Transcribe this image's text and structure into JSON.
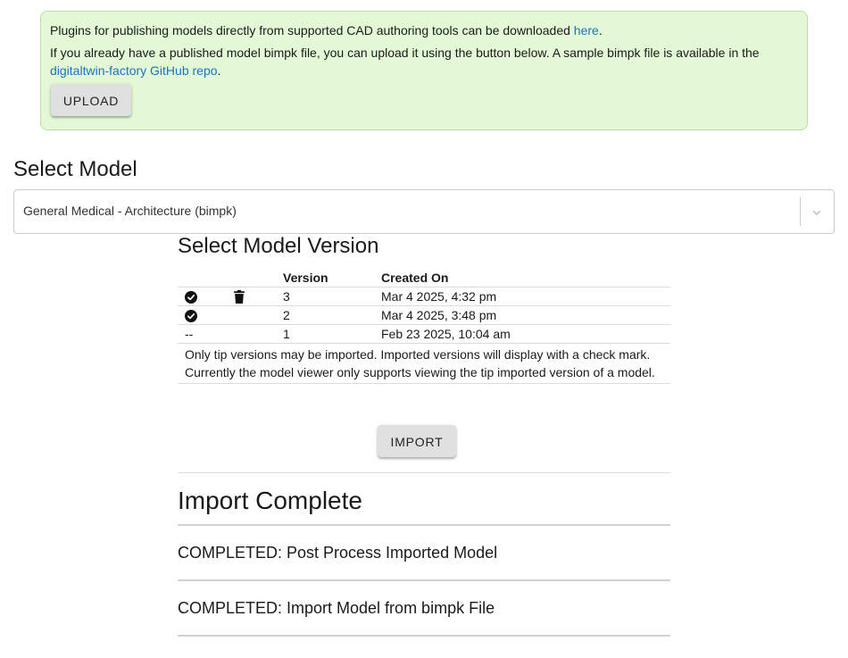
{
  "notice": {
    "line1_text": "Plugins for publishing models directly from supported CAD authoring tools can be downloaded ",
    "line1_link": "here",
    "line1_end": ".",
    "line2_text": "If you already have a published model bimpk file, you can upload it using the button below. A sample bimpk file is available in the ",
    "line2_link": "digitaltwin-factory GitHub repo",
    "line2_end": ".",
    "upload_label": "UPLOAD",
    "background_color": "#e3f9d6"
  },
  "select_model": {
    "heading": "Select Model",
    "selected_value": "General Medical - Architecture (bimpk)",
    "dropdown_icon": "chevron-down-icon"
  },
  "select_version": {
    "heading": "Select Model Version",
    "columns": [
      "",
      "",
      "Version",
      "Created On"
    ],
    "rows": [
      {
        "imported": "check-circle-icon",
        "action": "trash-icon",
        "version": "3",
        "created_on": "Mar 4 2025, 4:32 pm"
      },
      {
        "imported": "check-circle-icon",
        "action": "",
        "version": "2",
        "created_on": "Mar 4 2025, 3:48 pm"
      },
      {
        "imported_text": "--",
        "action": "",
        "version": "1",
        "created_on": "Feb 23 2025, 10:04 am"
      }
    ],
    "note": "Only tip versions may be imported. Imported versions will display with a check mark. Currently the model viewer only supports viewing the tip imported version of a model.",
    "import_label": "IMPORT"
  },
  "import_status": {
    "heading": "Import Complete",
    "items": [
      "COMPLETED: Post Process Imported Model",
      "COMPLETED: Import Model from bimpk File"
    ]
  }
}
